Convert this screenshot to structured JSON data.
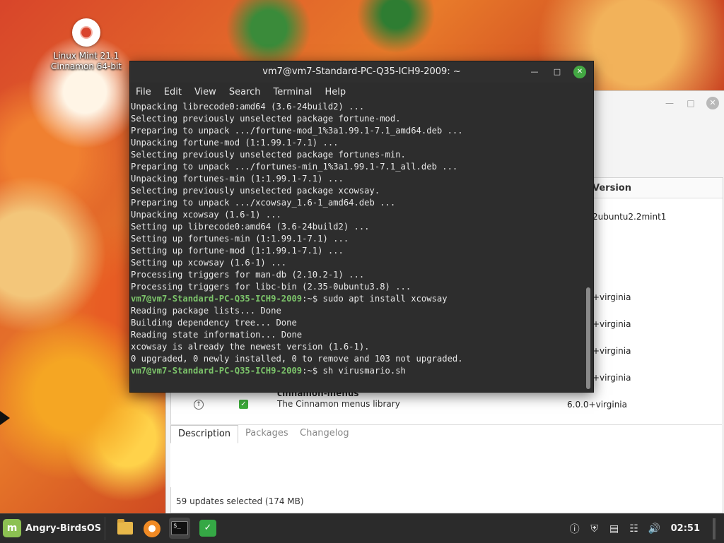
{
  "desktop": {
    "icon_label": "Linux Mint 21.1\nCinnamon 64-bit"
  },
  "terminal": {
    "title": "vm7@vm7-Standard-PC-Q35-ICH9-2009: ~",
    "menus": [
      "File",
      "Edit",
      "View",
      "Search",
      "Terminal",
      "Help"
    ],
    "lines": [
      {
        "prompt": "",
        "text": "Unpacking librecode0:amd64 (3.6-24build2) ..."
      },
      {
        "prompt": "",
        "text": "Selecting previously unselected package fortune-mod."
      },
      {
        "prompt": "",
        "text": "Preparing to unpack .../fortune-mod_1%3a1.99.1-7.1_amd64.deb ..."
      },
      {
        "prompt": "",
        "text": "Unpacking fortune-mod (1:1.99.1-7.1) ..."
      },
      {
        "prompt": "",
        "text": "Selecting previously unselected package fortunes-min."
      },
      {
        "prompt": "",
        "text": "Preparing to unpack .../fortunes-min_1%3a1.99.1-7.1_all.deb ..."
      },
      {
        "prompt": "",
        "text": "Unpacking fortunes-min (1:1.99.1-7.1) ..."
      },
      {
        "prompt": "",
        "text": "Selecting previously unselected package xcowsay."
      },
      {
        "prompt": "",
        "text": "Preparing to unpack .../xcowsay_1.6-1_amd64.deb ..."
      },
      {
        "prompt": "",
        "text": "Unpacking xcowsay (1.6-1) ..."
      },
      {
        "prompt": "",
        "text": "Setting up librecode0:amd64 (3.6-24build2) ..."
      },
      {
        "prompt": "",
        "text": "Setting up fortunes-min (1:1.99.1-7.1) ..."
      },
      {
        "prompt": "",
        "text": "Setting up fortune-mod (1:1.99.1-7.1) ..."
      },
      {
        "prompt": "",
        "text": "Setting up xcowsay (1.6-1) ..."
      },
      {
        "prompt": "",
        "text": "Processing triggers for man-db (2.10.2-1) ..."
      },
      {
        "prompt": "",
        "text": "Processing triggers for libc-bin (2.35-0ubuntu3.8) ..."
      },
      {
        "prompt": "vm7@vm7-Standard-PC-Q35-ICH9-2009",
        "text": ":~$ sudo apt install xcowsay"
      },
      {
        "prompt": "",
        "text": "Reading package lists... Done"
      },
      {
        "prompt": "",
        "text": "Building dependency tree... Done"
      },
      {
        "prompt": "",
        "text": "Reading state information... Done"
      },
      {
        "prompt": "",
        "text": "xcowsay is already the newest version (1.6-1)."
      },
      {
        "prompt": "",
        "text": "0 upgraded, 0 newly installed, 0 to remove and 103 not upgraded."
      },
      {
        "prompt": "vm7@vm7-Standard-PC-Q35-ICH9-2009",
        "text": ":~$ sh virusmario.sh"
      }
    ]
  },
  "update_manager": {
    "column_version": "Version",
    "rows": [
      {
        "version": "2ubuntu2.2mint1",
        "name": "",
        "desc": ""
      },
      {
        "version": "+virginia",
        "name": "",
        "desc": ""
      },
      {
        "version": "+virginia",
        "name": "",
        "desc": ""
      },
      {
        "version": "+virginia",
        "name": "",
        "desc": ""
      },
      {
        "version": "+virginia",
        "name": "",
        "desc": ""
      },
      {
        "version": "6.0.0+virginia",
        "name": "cinnamon-menus",
        "desc": "The Cinnamon menus library"
      }
    ],
    "tabs": [
      "Description",
      "Packages",
      "Changelog"
    ],
    "status": "59 updates selected (174 MB)"
  },
  "taskbar": {
    "menu_label": "Angry-BirdsOS",
    "clock": "02:51"
  },
  "colors": {
    "prompt": "#7cc46a",
    "terminal_bg": "#2d2d2d",
    "accent_green": "#43a843"
  }
}
